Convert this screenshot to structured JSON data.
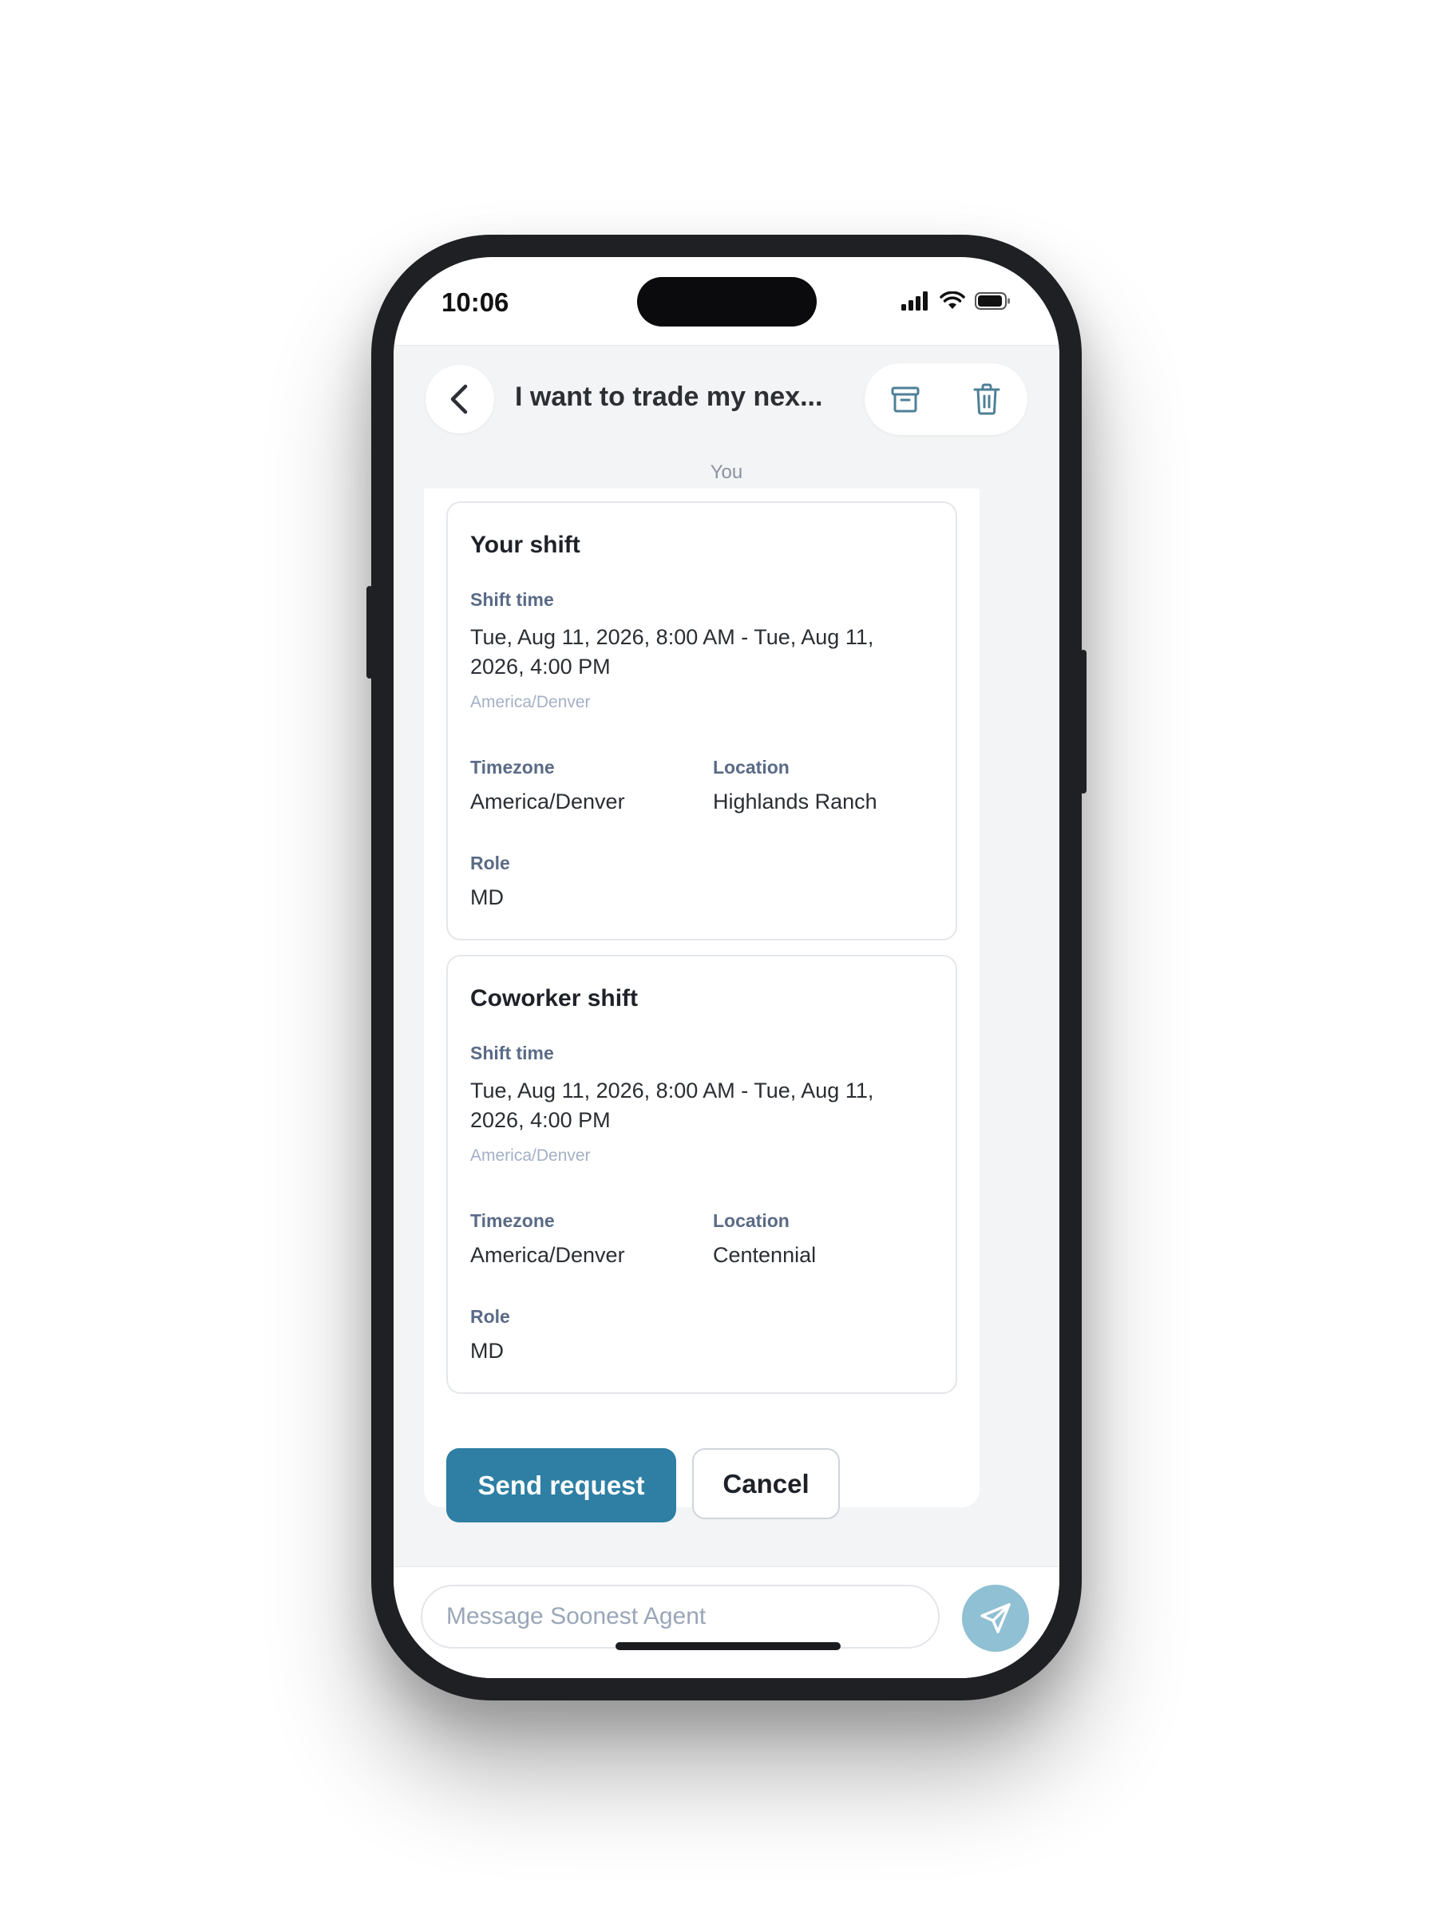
{
  "status_bar": {
    "time": "10:06"
  },
  "header": {
    "title": "I want to trade my nex...",
    "back_icon": "chevron-left-icon",
    "archive_icon": "archive-icon",
    "delete_icon": "trash-icon"
  },
  "chat": {
    "sender": "You",
    "your_shift": {
      "title": "Your shift",
      "shift_time_label": "Shift time",
      "shift_time_line1": "Tue, Aug 11, 2026, 8:00 AM - Tue, Aug 11,",
      "shift_time_line2": "2026, 4:00 PM",
      "shift_time_zone": "America/Denver",
      "timezone_label": "Timezone",
      "timezone": "America/Denver",
      "location_label": "Location",
      "location": "Highlands Ranch",
      "role_label": "Role",
      "role": "MD"
    },
    "coworker_shift": {
      "title": "Coworker shift",
      "shift_time_label": "Shift time",
      "shift_time_line1": "Tue, Aug 11, 2026, 8:00 AM - Tue, Aug 11,",
      "shift_time_line2": "2026, 4:00 PM",
      "shift_time_zone": "America/Denver",
      "timezone_label": "Timezone",
      "timezone": "America/Denver",
      "location_label": "Location",
      "location": "Centennial",
      "role_label": "Role",
      "role": "MD"
    },
    "send_request_label": "Send request",
    "cancel_label": "Cancel"
  },
  "composer": {
    "placeholder": "Message Soonest Agent",
    "send_icon": "send-icon"
  },
  "colors": {
    "primary": "#2e7fa3",
    "send_button": "#8fc0d3",
    "label": "#5a6a86",
    "background": "#f3f4f5"
  }
}
